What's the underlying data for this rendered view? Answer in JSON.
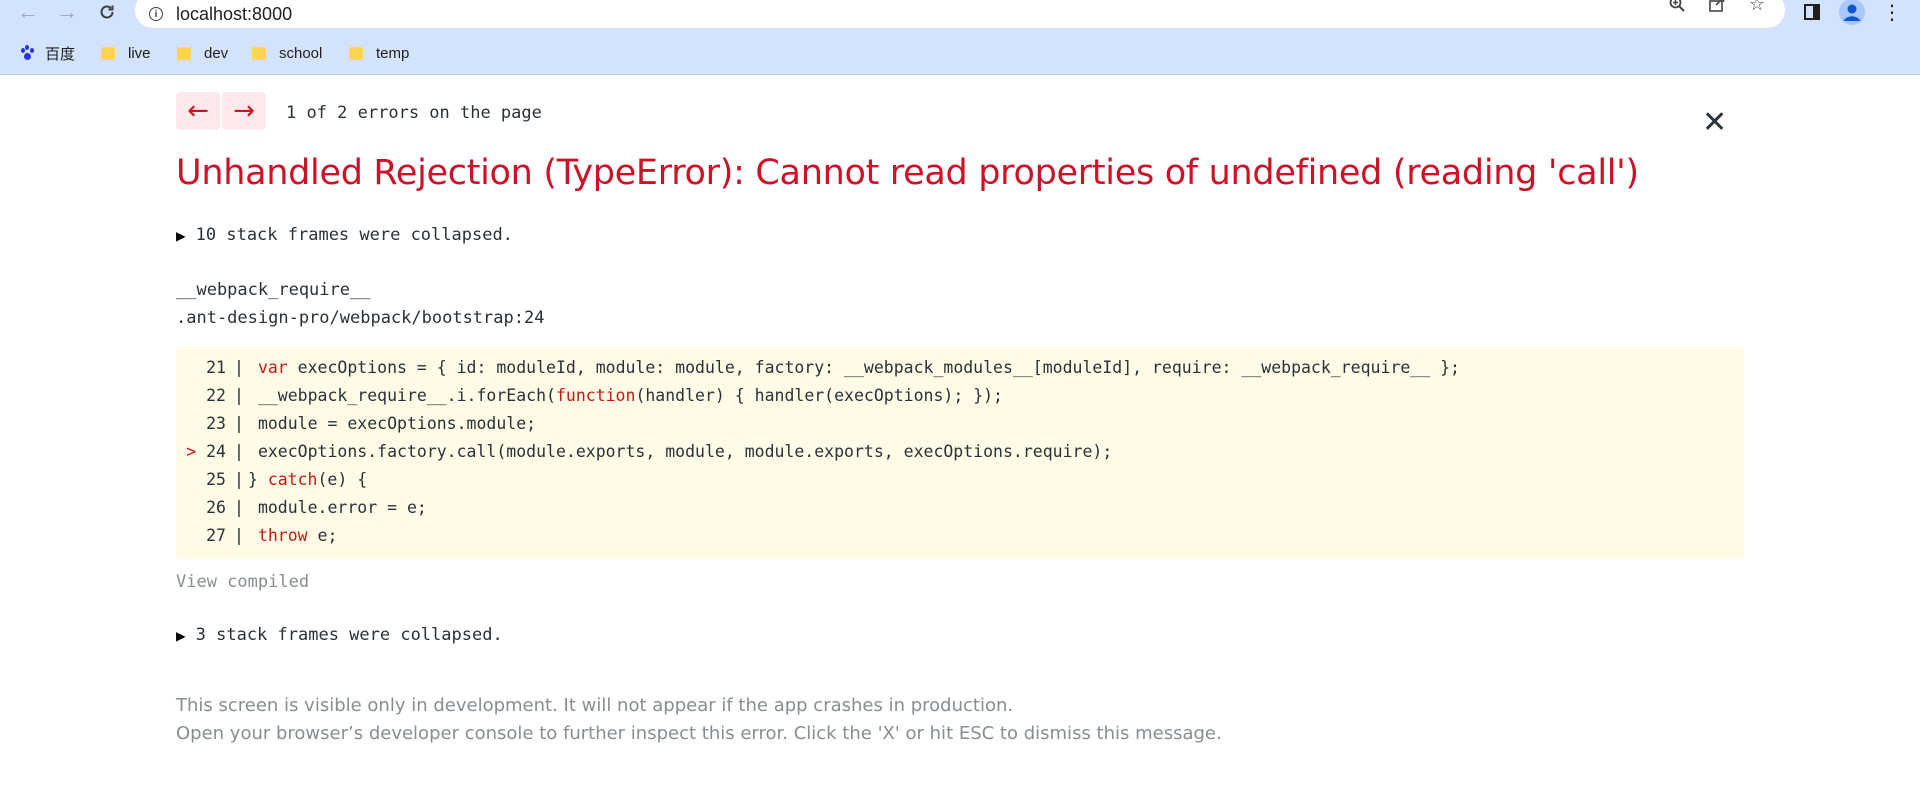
{
  "browser": {
    "url": "localhost:8000",
    "bookmarks": [
      {
        "label": "百度",
        "icon": "baidu-icon"
      },
      {
        "label": "live",
        "icon": "folder-icon"
      },
      {
        "label": "dev",
        "icon": "folder-icon"
      },
      {
        "label": "school",
        "icon": "folder-icon"
      },
      {
        "label": "temp",
        "icon": "folder-icon"
      }
    ]
  },
  "overlay": {
    "prev_label": "←",
    "next_label": "→",
    "error_count": "1 of 2 errors on the page",
    "close_label": "✕",
    "title": "Unhandled Rejection (TypeError): Cannot read properties of undefined (reading 'call')",
    "collapsed_top": "10 stack frames were collapsed.",
    "frame": {
      "function": "__webpack_require__",
      "location": ".ant-design-pro/webpack/bootstrap:24"
    },
    "code_lines": [
      {
        "num": "21",
        "highlight": false
      },
      {
        "num": "22",
        "highlight": false
      },
      {
        "num": "23",
        "highlight": false
      },
      {
        "num": "24",
        "highlight": true
      },
      {
        "num": "25",
        "highlight": false
      },
      {
        "num": "26",
        "highlight": false
      },
      {
        "num": "27",
        "highlight": false
      }
    ],
    "code_text": {
      "l21": {
        "kw": "var",
        "rest": " execOptions = { id: moduleId, module: module, factory: __webpack_modules__[moduleId], require: __webpack_require__ };"
      },
      "l22": {
        "a": "__webpack_require__.i.forEach(",
        "kw": "function",
        "b": "(handler) { handler(execOptions); });"
      },
      "l23": {
        "text": "module = execOptions.module;"
      },
      "l24": {
        "text": "execOptions.factory.call(module.exports, module, module.exports, execOptions.require);"
      },
      "l25": {
        "a": "} ",
        "kw": "catch",
        "b": "(e) {"
      },
      "l26": {
        "text": "module.error = e;"
      },
      "l27": {
        "kw": "throw",
        "rest": " e;"
      }
    },
    "view_compiled": "View compiled",
    "collapsed_bottom": "3 stack frames were collapsed.",
    "footer_line1": "This screen is visible only in development. It will not appear if the app crashes in production.",
    "footer_line2": "Open your browser’s developer console to further inspect this error.  Click the 'X' or hit ESC to dismiss this message."
  },
  "colors": {
    "error_red": "#ce1126",
    "code_bg": "#fffbe6",
    "muted_gray": "#878e91",
    "chrome_blue": "#d3e3fd"
  }
}
